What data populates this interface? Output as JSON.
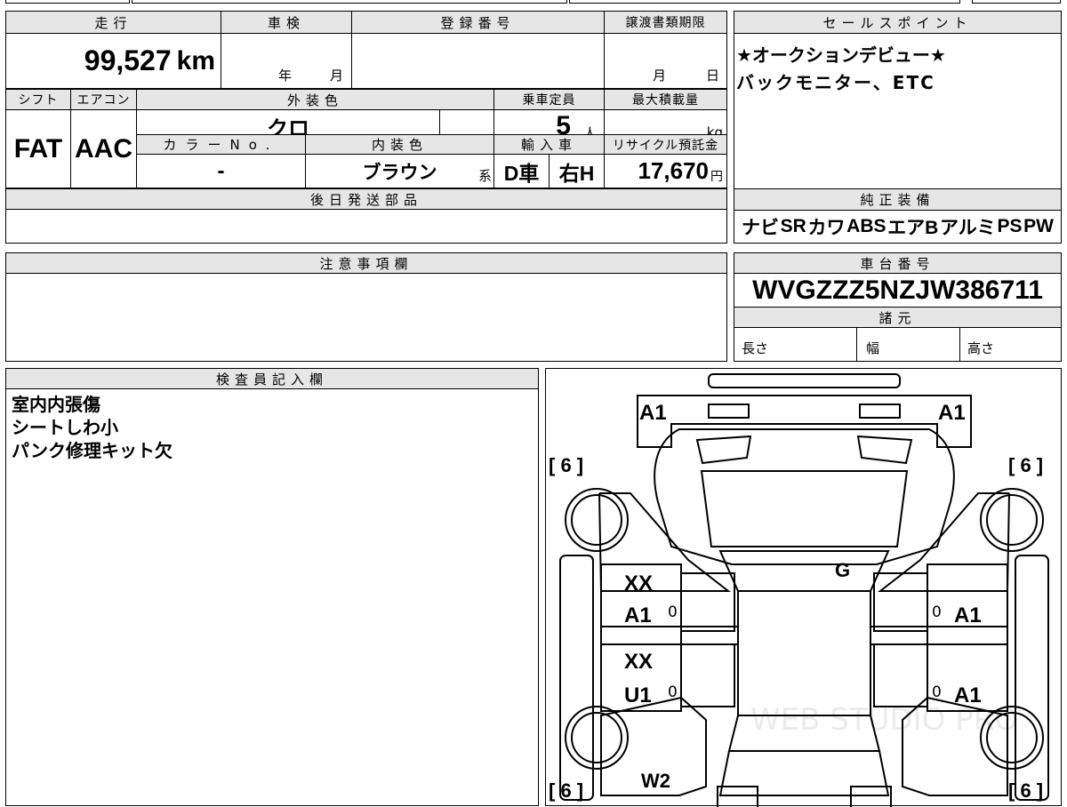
{
  "top": {
    "mileage_label": "走行",
    "shaken_label": "車検",
    "registration_label": "登録番号",
    "transfer_deadline_label": "譲渡書類期限",
    "mileage_value": "99,527",
    "mileage_unit": "km",
    "year_unit": "年",
    "month_unit": "月",
    "deadline_month_unit": "月",
    "deadline_day_unit": "日"
  },
  "row2": {
    "shift_label": "シフト",
    "aircon_label": "エアコン",
    "exterior_color_label": "外装色",
    "capacity_label": "乗車定員",
    "max_load_label": "最大積載量",
    "shift_value": "FAT",
    "aircon_value": "AAC",
    "exterior_color_value": "クロ",
    "capacity_value": "5",
    "capacity_unit": "人",
    "max_load_unit": "kg",
    "color_no_label": "カラーNo.",
    "interior_color_label": "内装色",
    "import_label": "輸入車",
    "recycle_label": "リサイクル預託金",
    "color_no_value": "-",
    "interior_color_value": "ブラウン",
    "interior_suffix": "系",
    "dealer_value": "D車",
    "handle_value": "右H",
    "recycle_value": "17,670",
    "recycle_unit": "円"
  },
  "later_parts_label": "後日発送部品",
  "notes_label": "注意事項欄",
  "sales_point": {
    "label": "セールスポイント",
    "line1": "★オークションデビュー★",
    "line2": "バックモニター、ETC"
  },
  "equipment": {
    "label": "純正装備",
    "items": [
      "ナビ",
      "SR",
      "カワ",
      "ABS",
      "エアB",
      "アルミ",
      "PS",
      "PW"
    ]
  },
  "chassis": {
    "label": "車台番号",
    "value": "WVGZZZ5NZJW386711"
  },
  "specs": {
    "label": "諸元",
    "length": "長さ",
    "width": "幅",
    "height": "高さ"
  },
  "inspector": {
    "label": "検査員記入欄",
    "lines": [
      "室内内張傷",
      "シートしわ小",
      "パンク修理キット欠"
    ]
  },
  "diagram": {
    "front_left": "A1",
    "front_right": "A1",
    "tire_fl": "[ 6 ]",
    "tire_fr": "[ 6 ]",
    "tire_rl": "[ 6 ]",
    "tire_rr": "[ 6 ]",
    "windshield": "G",
    "front_door_left_1": "XX",
    "front_door_left_2": "A1",
    "front_door_left_sub": "0",
    "front_door_right": "A1",
    "front_door_right_sub": "0",
    "rear_door_left_1": "XX",
    "rear_door_left_2": "U1",
    "rear_door_left_sub": "0",
    "rear_door_right": "A1",
    "rear_door_right_sub": "0",
    "rear_left": "W2"
  },
  "watermark": "WEB STUDIO PRO"
}
